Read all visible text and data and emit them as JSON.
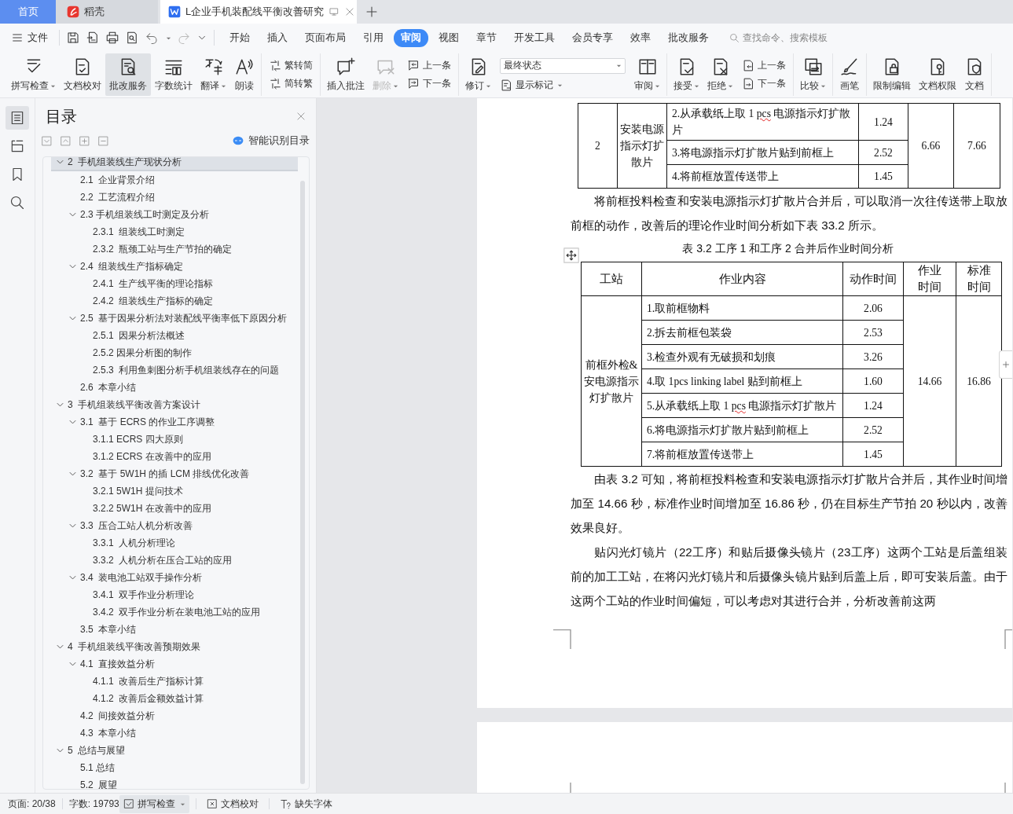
{
  "tabs": [
    {
      "kind": "home",
      "label": "首页",
      "selected": false
    },
    {
      "kind": "app",
      "label": "稻壳",
      "selected": false
    },
    {
      "kind": "document",
      "label": "L企业手机装配线平衡改善研究",
      "selected": true
    }
  ],
  "menu": {
    "file_label": "文件",
    "tabs": [
      {
        "label": "开始",
        "selected": false
      },
      {
        "label": "插入",
        "selected": false
      },
      {
        "label": "页面布局",
        "selected": false
      },
      {
        "label": "引用",
        "selected": false
      },
      {
        "label": "审阅",
        "selected": true
      },
      {
        "label": "视图",
        "selected": false
      },
      {
        "label": "章节",
        "selected": false
      },
      {
        "label": "开发工具",
        "selected": false
      },
      {
        "label": "会员专享",
        "selected": false
      },
      {
        "label": "效率",
        "selected": false
      },
      {
        "label": "批改服务",
        "selected": false
      }
    ],
    "search": {
      "placeholder": "查找命令、搜索模板"
    }
  },
  "ribbon": {
    "groups": [
      [
        {
          "kind": "large",
          "label": "拼写检查",
          "caret": true,
          "active": false,
          "disabled": false
        },
        {
          "kind": "large",
          "label": "文档校对",
          "caret": false,
          "active": false,
          "disabled": false
        },
        {
          "kind": "large",
          "label": "批改服务",
          "caret": false,
          "active": true,
          "disabled": false
        },
        {
          "kind": "large",
          "label": "字数统计",
          "caret": false,
          "active": false,
          "disabled": false
        },
        {
          "kind": "large",
          "label": "翻译",
          "caret": true,
          "active": false,
          "disabled": false
        },
        {
          "kind": "large",
          "label": "朗读",
          "caret": false,
          "active": false,
          "disabled": false
        }
      ],
      [
        {
          "kind": "pair",
          "items": [
            {
              "label": "繁转简"
            },
            {
              "label": "简转繁"
            }
          ]
        }
      ],
      [
        {
          "kind": "large",
          "label": "插入批注",
          "caret": false,
          "active": false,
          "disabled": false
        },
        {
          "kind": "large",
          "label": "删除",
          "caret": true,
          "active": false,
          "disabled": true
        },
        {
          "kind": "pair",
          "items": [
            {
              "label": "上一条"
            },
            {
              "label": "下一条"
            }
          ]
        }
      ],
      [
        {
          "kind": "large",
          "label": "修订",
          "caret": true,
          "active": false,
          "disabled": false
        },
        {
          "kind": "select",
          "value": "最终状态",
          "below": {
            "label": "显示标记",
            "caret": true
          }
        },
        {
          "kind": "large",
          "label": "审阅",
          "caret": true,
          "active": false,
          "disabled": false
        }
      ],
      [
        {
          "kind": "large",
          "label": "接受",
          "caret": true,
          "active": false,
          "disabled": false
        },
        {
          "kind": "large",
          "label": "拒绝",
          "caret": true,
          "active": false,
          "disabled": false
        },
        {
          "kind": "pair",
          "items": [
            {
              "label": "上一条"
            },
            {
              "label": "下一条"
            }
          ]
        }
      ],
      [
        {
          "kind": "large",
          "label": "比较",
          "caret": true,
          "active": false,
          "disabled": false
        }
      ],
      [
        {
          "kind": "large",
          "label": "画笔",
          "caret": false,
          "active": false,
          "disabled": false
        }
      ],
      [
        {
          "kind": "large",
          "label": "限制编辑",
          "caret": false,
          "active": false,
          "disabled": false
        },
        {
          "kind": "large",
          "label": "文档权限",
          "caret": false,
          "active": false,
          "disabled": false
        },
        {
          "kind": "large",
          "label": "文档",
          "caret": false,
          "active": false,
          "disabled": false
        }
      ]
    ]
  },
  "sidebar_rail": [
    {
      "selected": true
    },
    {
      "selected": false
    },
    {
      "selected": false
    },
    {
      "selected": false
    }
  ],
  "toc": {
    "title": "目录",
    "smart_button": "智能识别目录",
    "items": [
      {
        "text": "2  手机组装线生产现状分析",
        "expanded": true,
        "selected": true,
        "children": [
          {
            "text": "2.1  企业背景介绍",
            "selected": false
          },
          {
            "text": "2.2  工艺流程介绍",
            "selected": false
          },
          {
            "text": "2.3 手机组装线工时测定及分析",
            "expanded": true,
            "selected": false,
            "children": [
              {
                "text": "2.3.1  组装线工时测定",
                "selected": false
              },
              {
                "text": "2.3.2  瓶颈工站与生产节拍的确定",
                "selected": false
              }
            ]
          },
          {
            "text": "2.4  组装线生产指标确定",
            "expanded": true,
            "selected": false,
            "children": [
              {
                "text": "2.4.1  生产线平衡的理论指标",
                "selected": false
              },
              {
                "text": "2.4.2  组装线生产指标的确定",
                "selected": false
              }
            ]
          },
          {
            "text": "2.5  基于因果分析法对装配线平衡率低下原因分析",
            "expanded": true,
            "selected": false,
            "children": [
              {
                "text": "2.5.1  因果分析法概述",
                "selected": false
              },
              {
                "text": "2.5.2 因果分析图的制作",
                "selected": false
              },
              {
                "text": "2.5.3  利用鱼刺图分析手机组装线存在的问题",
                "selected": false
              }
            ]
          },
          {
            "text": "2.6  本章小结",
            "selected": false
          }
        ]
      },
      {
        "text": "3  手机组装线平衡改善方案设计",
        "expanded": true,
        "selected": false,
        "children": [
          {
            "text": "3.1  基于 ECRS 的作业工序调整",
            "expanded": true,
            "selected": false,
            "children": [
              {
                "text": "3.1.1 ECRS 四大原则",
                "selected": false
              },
              {
                "text": "3.1.2 ECRS 在改善中的应用",
                "selected": false
              }
            ]
          },
          {
            "text": "3.2  基于 5W1H 的插 LCM 排线优化改善",
            "expanded": true,
            "selected": false,
            "children": [
              {
                "text": "3.2.1 5W1H 提问技术",
                "selected": false
              },
              {
                "text": "3.2.2 5W1H 在改善中的应用",
                "selected": false
              }
            ]
          },
          {
            "text": "3.3  压合工站人机分析改善",
            "expanded": true,
            "selected": false,
            "children": [
              {
                "text": "3.3.1  人机分析理论",
                "selected": false
              },
              {
                "text": "3.3.2  人机分析在压合工站的应用",
                "selected": false
              }
            ]
          },
          {
            "text": "3.4  装电池工站双手操作分析",
            "expanded": true,
            "selected": false,
            "children": [
              {
                "text": "3.4.1  双手作业分析理论",
                "selected": false
              },
              {
                "text": "3.4.2  双手作业分析在装电池工站的应用",
                "selected": false
              }
            ]
          },
          {
            "text": "3.5  本章小结",
            "selected": false
          }
        ]
      },
      {
        "text": "4  手机组装线平衡改善预期效果",
        "expanded": true,
        "selected": false,
        "children": [
          {
            "text": "4.1  直接效益分析",
            "expanded": true,
            "selected": false,
            "children": [
              {
                "text": "4.1.1  改善后生产指标计算",
                "selected": false
              },
              {
                "text": "4.1.2  改善后金额效益计算",
                "selected": false
              }
            ]
          },
          {
            "text": "4.2  间接效益分析",
            "selected": false
          },
          {
            "text": "4.3  本章小结",
            "selected": false
          }
        ]
      },
      {
        "text": "5  总结与展望",
        "expanded": true,
        "selected": false,
        "children": [
          {
            "text": "5.1 总结",
            "selected": false
          },
          {
            "text": "5.2  展望",
            "selected": false
          }
        ]
      }
    ]
  },
  "document": {
    "blocks": [
      {
        "kind": "table",
        "rows": [
          [
            {
              "kind": "value",
              "text": "2",
              "rowspan": 3
            },
            {
              "kind": "label",
              "text": "安装电源指示灯扩散片",
              "rowspan": 3
            },
            {
              "kind": "step",
              "segments": [
                {
                  "text": "2.从承载纸上取 1 ",
                  "flagged": false
                },
                {
                  "text": "pcs",
                  "flagged": true
                },
                {
                  "text": " 电源指示灯扩散片",
                  "flagged": false
                }
              ]
            },
            {
              "kind": "value",
              "text": "1.24"
            },
            {
              "kind": "value",
              "text": "6.66",
              "rowspan": 3
            },
            {
              "kind": "value",
              "text": "7.66",
              "rowspan": 3
            }
          ],
          [
            {
              "kind": "step",
              "text": "3.将电源指示灯扩散片贴到前框上"
            },
            {
              "kind": "value",
              "text": "2.52"
            }
          ],
          [
            {
              "kind": "step",
              "text": "4.将前框放置传送带上"
            },
            {
              "kind": "value",
              "text": "1.45"
            }
          ]
        ]
      },
      {
        "kind": "paragraph",
        "text": "将前框投料检查和安装电源指示灯扩散片合并后，可以取消一次往传送带上取放前框的动作，改善后的理论作业时间分析如下表 33.2 所示。"
      },
      {
        "kind": "caption",
        "text": "表 3.2  工序 1 和工序 2 合并后作业时间分析"
      },
      {
        "kind": "table",
        "rows": [
          [
            {
              "kind": "header",
              "text": "工站"
            },
            {
              "kind": "header",
              "text": "作业内容"
            },
            {
              "kind": "header",
              "text": "动作时间"
            },
            {
              "kind": "header",
              "text": "作业时间"
            },
            {
              "kind": "header",
              "text": "标准时间"
            }
          ],
          [
            {
              "kind": "label",
              "text": "前框外检&安电源指示灯扩散片",
              "rowspan": 7
            },
            {
              "kind": "step",
              "text": "1.取前框物料"
            },
            {
              "kind": "value",
              "text": "2.06"
            },
            {
              "kind": "value",
              "text": "14.66",
              "rowspan": 7
            },
            {
              "kind": "value",
              "text": "16.86",
              "rowspan": 7
            }
          ],
          [
            {
              "kind": "step",
              "text": "2.拆去前框包装袋"
            },
            {
              "kind": "value",
              "text": "2.53"
            }
          ],
          [
            {
              "kind": "step",
              "text": "3.检查外观有无破损和划痕"
            },
            {
              "kind": "value",
              "text": "3.26"
            }
          ],
          [
            {
              "kind": "step",
              "text": "4.取 1pcs linking label 贴到前框上"
            },
            {
              "kind": "value",
              "text": "1.60"
            }
          ],
          [
            {
              "kind": "step",
              "segments": [
                {
                  "text": "5.从承载纸上取 1 ",
                  "flagged": false
                },
                {
                  "text": "pcs",
                  "flagged": true
                },
                {
                  "text": " 电源指示灯扩散片",
                  "flagged": false
                }
              ]
            },
            {
              "kind": "value",
              "text": "1.24"
            }
          ],
          [
            {
              "kind": "step",
              "text": "6.将电源指示灯扩散片贴到前框上"
            },
            {
              "kind": "value",
              "text": "2.52"
            }
          ],
          [
            {
              "kind": "step",
              "text": "7.将前框放置传送带上"
            },
            {
              "kind": "value",
              "text": "1.45"
            }
          ]
        ]
      },
      {
        "kind": "paragraph",
        "text": "由表 3.2 可知，将前框投料检查和安装电源指示灯扩散片合并后，其作业时间增加至 14.66 秒，标准作业时间增加至 16.86 秒，仍在目标生产节拍 20 秒以内，改善效果良好。"
      },
      {
        "kind": "paragraph",
        "text": "贴闪光灯镜片（22工序）和贴后摄像头镜片（23工序）这两个工站是后盖组装前的加工工站，在将闪光灯镜片和后摄像头镜片贴到后盖上后，即可安装后盖。由于这两个工站的作业时间偏短，可以考虑对其进行合并，分析改善前这两"
      }
    ]
  },
  "status_bar": {
    "page": "页面: 20/38",
    "words": "字数: 19793",
    "spellcheck": {
      "label": "拼写检查",
      "caret": true,
      "active": true
    },
    "proofread": "文档校对",
    "missing_fonts": "缺失字体"
  }
}
